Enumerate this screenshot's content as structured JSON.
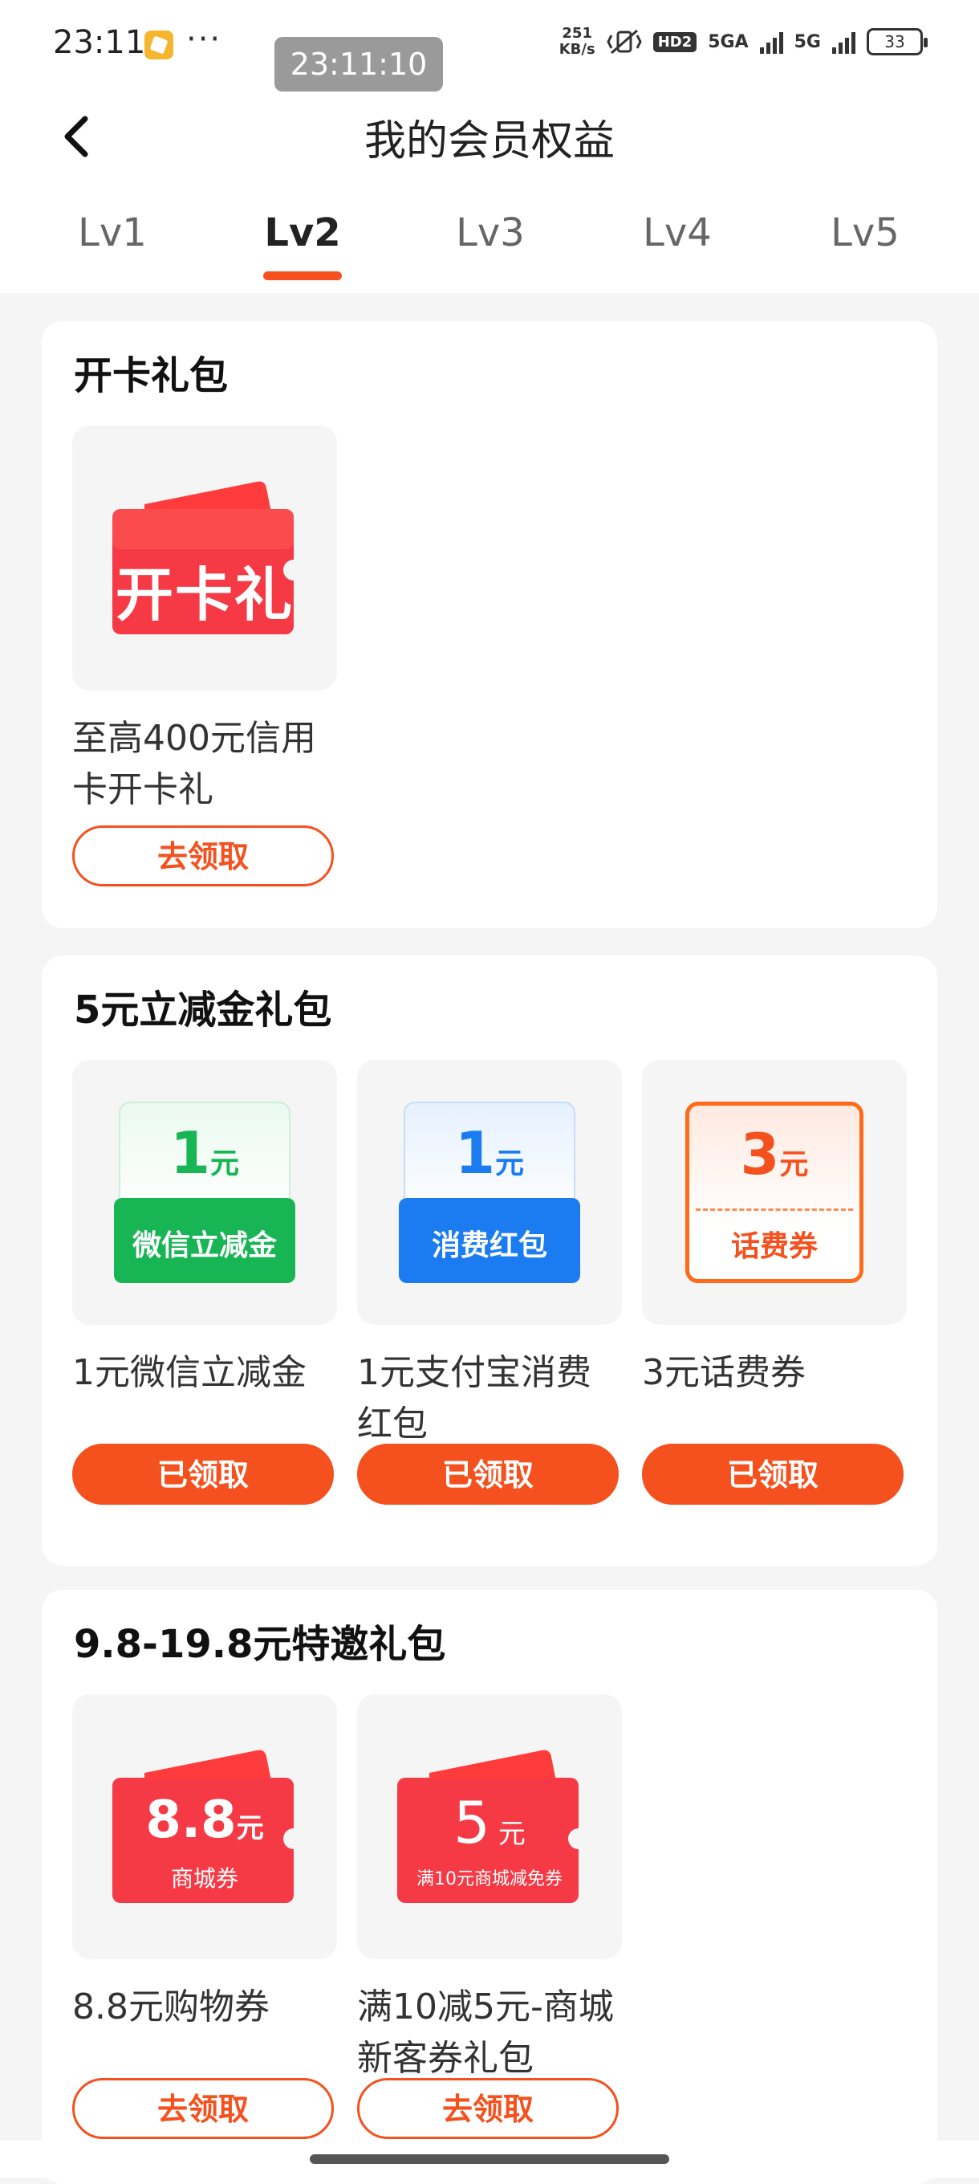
{
  "status_bar": {
    "time": "23:11",
    "dots": "···",
    "clock_pill": "23:11:10",
    "net_speed_top": "251",
    "net_speed_bottom": "KB/s",
    "hd": "HD2",
    "sig1": "5GA",
    "sig2": "5G",
    "battery": "33"
  },
  "header": {
    "title": "我的会员权益"
  },
  "tabs": [
    {
      "label": "Lv1"
    },
    {
      "label": "Lv2",
      "active": true
    },
    {
      "label": "Lv3"
    },
    {
      "label": "Lv4"
    },
    {
      "label": "Lv5"
    }
  ],
  "sections": [
    {
      "title": "开卡礼包",
      "items": [
        {
          "art_text": "开卡礼",
          "name_line1": "至高400元信用",
          "name_line2": "卡开卡礼",
          "button": "去领取"
        }
      ]
    },
    {
      "title": "5元立减金礼包",
      "items": [
        {
          "art_value": "1",
          "art_unit": "元",
          "art_label": "微信立减金",
          "name_line1": "1元微信立减金",
          "name_line2": "",
          "button": "已领取"
        },
        {
          "art_value": "1",
          "art_unit": "元",
          "art_label": "消费红包",
          "name_line1": "1元支付宝消费",
          "name_line2": "红包",
          "button": "已领取"
        },
        {
          "art_value": "3",
          "art_unit": "元",
          "art_label": "话费券",
          "name_line1": "3元话费券",
          "name_line2": "",
          "button": "已领取"
        }
      ]
    },
    {
      "title": "9.8-19.8元特邀礼包",
      "items": [
        {
          "art_value": "8.8",
          "art_unit": "元",
          "art_label": "商城券",
          "name_line1": "8.8元购物券",
          "name_line2": "",
          "button": "去领取"
        },
        {
          "art_value": "5",
          "art_unit": "元",
          "art_label": "满10元商城减免券",
          "name_line1": "满10减5元-商城",
          "name_line2": "新客券礼包",
          "button": "去领取"
        }
      ]
    }
  ],
  "colors": {
    "accent": "#f4511e",
    "wechat_green": "#18b555",
    "alipay_blue": "#1a7cf0"
  }
}
